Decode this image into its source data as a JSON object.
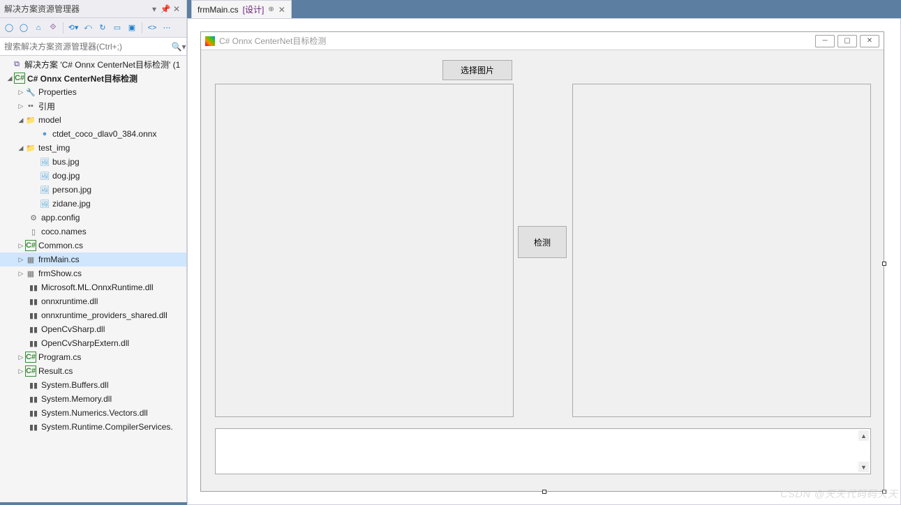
{
  "solution_explorer": {
    "title": "解决方案资源管理器",
    "search_placeholder": "搜索解决方案资源管理器(Ctrl+;)",
    "solution_label": "解决方案 'C# Onnx CenterNet目标检测' (1",
    "project_label": "C# Onnx CenterNet目标检测",
    "items": {
      "properties": "Properties",
      "references": "引用",
      "model": "model",
      "model_file": "ctdet_coco_dlav0_384.onnx",
      "test_img": "test_img",
      "img1": "bus.jpg",
      "img2": "dog.jpg",
      "img3": "person.jpg",
      "img4": "zidane.jpg",
      "appconfig": "app.config",
      "coconames": "coco.names",
      "common": "Common.cs",
      "frmmain": "frmMain.cs",
      "frmshow": "frmShow.cs",
      "dll1": "Microsoft.ML.OnnxRuntime.dll",
      "dll2": "onnxruntime.dll",
      "dll3": "onnxruntime_providers_shared.dll",
      "dll4": "OpenCvSharp.dll",
      "dll5": "OpenCvSharpExtern.dll",
      "program": "Program.cs",
      "result": "Result.cs",
      "dll6": "System.Buffers.dll",
      "dll7": "System.Memory.dll",
      "dll8": "System.Numerics.Vectors.dll",
      "dll9": "System.Runtime.CompilerServices."
    }
  },
  "tab": {
    "filename": "frmMain.cs",
    "mode": "[设计]"
  },
  "form": {
    "title": "C# Onnx CenterNet目标检测",
    "select_image_btn": "选择图片",
    "detect_btn": "检测"
  },
  "watermark": "CSDN @天天代码码天天"
}
